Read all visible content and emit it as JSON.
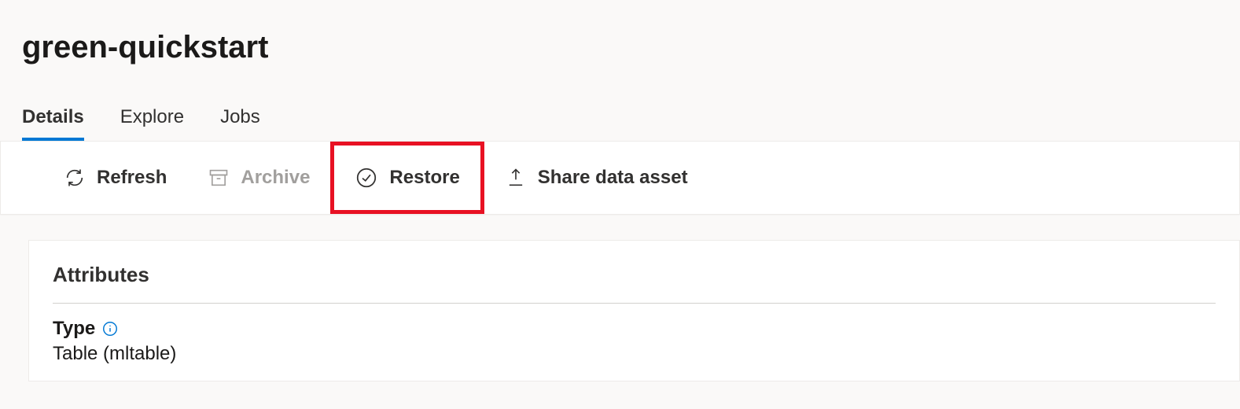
{
  "header": {
    "title": "green-quickstart"
  },
  "tabs": {
    "details": "Details",
    "explore": "Explore",
    "jobs": "Jobs"
  },
  "toolbar": {
    "refresh_label": "Refresh",
    "archive_label": "Archive",
    "restore_label": "Restore",
    "share_label": "Share data asset"
  },
  "attributes": {
    "panel_title": "Attributes",
    "type_label": "Type",
    "type_value": "Table (mltable)"
  }
}
